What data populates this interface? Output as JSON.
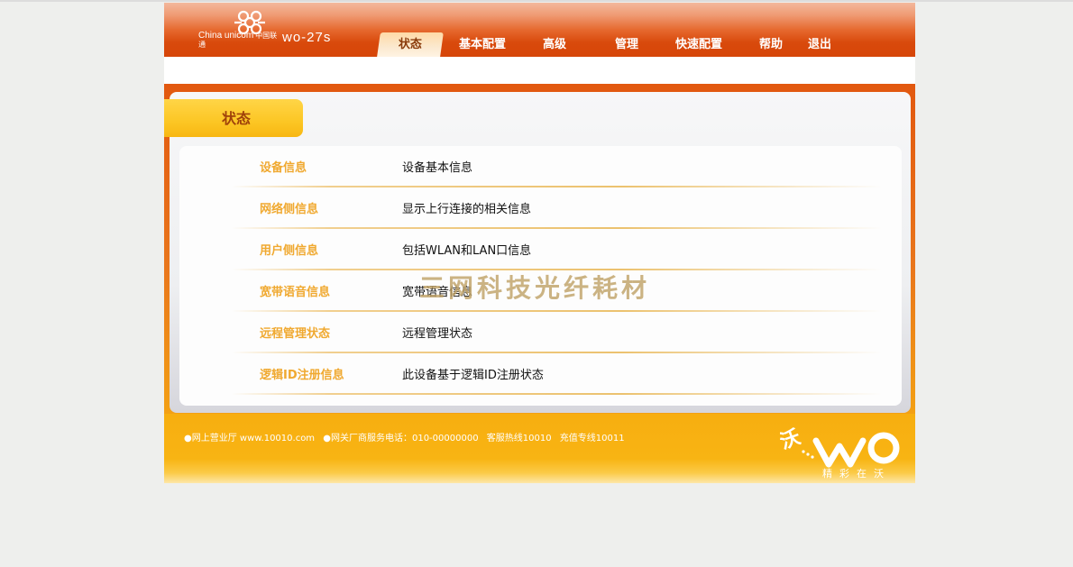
{
  "header": {
    "brand_en": "China unicom",
    "brand_cn": "中国联通",
    "model": "wo-27s"
  },
  "nav": {
    "items": [
      {
        "label": "状态",
        "active": true
      },
      {
        "label": "基本配置"
      },
      {
        "label": "高级"
      },
      {
        "label": "管理"
      },
      {
        "label": "快速配置"
      },
      {
        "label": "帮助"
      },
      {
        "label": "退出"
      }
    ]
  },
  "section": {
    "title": "状态"
  },
  "rows": [
    {
      "name": "设备信息",
      "desc": "设备基本信息"
    },
    {
      "name": "网络侧信息",
      "desc": "显示上行连接的相关信息"
    },
    {
      "name": "用户侧信息",
      "desc": "包括WLAN和LAN口信息"
    },
    {
      "name": "宽带语音信息",
      "desc": "宽带语音信息"
    },
    {
      "name": "远程管理状态",
      "desc": "远程管理状态"
    },
    {
      "name": "逻辑ID注册信息",
      "desc": "此设备基于逻辑ID注册状态"
    }
  ],
  "watermark": "三网科技光纤耗材",
  "footer": {
    "hall": "●网上营业厅 www.10010.com",
    "vendor_phone": "●网关厂商服务电话：010-00000000",
    "hotline": "客服热线10010",
    "recharge": "充值专线10011",
    "logo_char": "沃",
    "slogan": "精彩在沃"
  },
  "colors": {
    "header_orange": "#d64508",
    "accent_yellow": "#f8b712",
    "row_name": "#f0a930"
  }
}
